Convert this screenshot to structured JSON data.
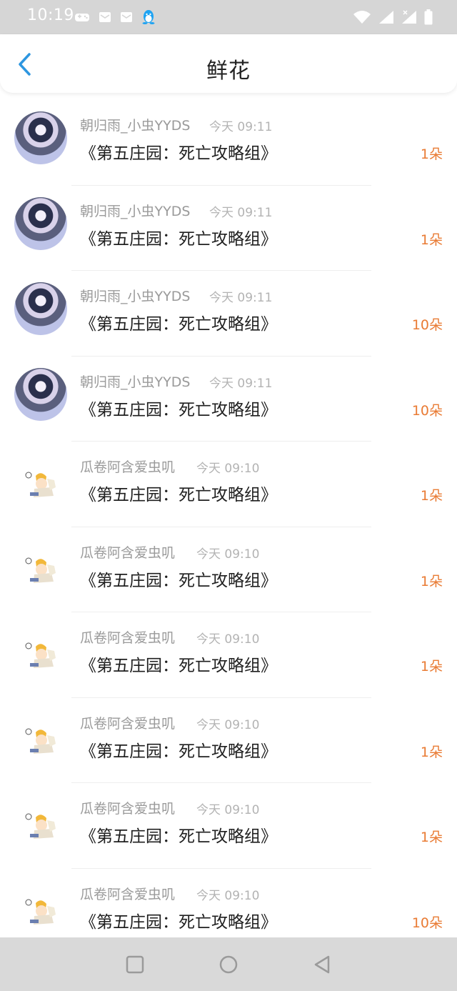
{
  "status_bar": {
    "time": "10:19",
    "left_icons": [
      "game-controller-icon",
      "mail-icon",
      "mail-icon",
      "qq-penguin-icon"
    ],
    "right_icons": [
      "wifi-icon",
      "signal-icon",
      "signal-icon",
      "battery-icon"
    ]
  },
  "header": {
    "title": "鲜花"
  },
  "colors": {
    "accent_blue": "#2d96e0",
    "count_orange": "#e97b34",
    "name_gray": "#9a9a9a",
    "time_gray": "#b3b3b3"
  },
  "items": [
    {
      "name": "朝归雨_小虫YYDS",
      "time": "今天 09:11",
      "title": "《第五庄园：死亡攻略组》",
      "count": "1朵"
    },
    {
      "name": "朝归雨_小虫YYDS",
      "time": "今天 09:11",
      "title": "《第五庄园：死亡攻略组》",
      "count": "1朵"
    },
    {
      "name": "朝归雨_小虫YYDS",
      "time": "今天 09:11",
      "title": "《第五庄园：死亡攻略组》",
      "count": "10朵"
    },
    {
      "name": "朝归雨_小虫YYDS",
      "time": "今天 09:11",
      "title": "《第五庄园：死亡攻略组》",
      "count": "10朵"
    },
    {
      "name": "瓜卷阿含爱虫叽",
      "time": "今天 09:10",
      "title": "《第五庄园：死亡攻略组》",
      "count": "1朵"
    },
    {
      "name": "瓜卷阿含爱虫叽",
      "time": "今天 09:10",
      "title": "《第五庄园：死亡攻略组》",
      "count": "1朵"
    },
    {
      "name": "瓜卷阿含爱虫叽",
      "time": "今天 09:10",
      "title": "《第五庄园：死亡攻略组》",
      "count": "1朵"
    },
    {
      "name": "瓜卷阿含爱虫叽",
      "time": "今天 09:10",
      "title": "《第五庄园：死亡攻略组》",
      "count": "1朵"
    },
    {
      "name": "瓜卷阿含爱虫叽",
      "time": "今天 09:10",
      "title": "《第五庄园：死亡攻略组》",
      "count": "1朵"
    },
    {
      "name": "瓜卷阿含爱虫叽",
      "time": "今天 09:10",
      "title": "《第五庄园：死亡攻略组》",
      "count": "10朵"
    }
  ],
  "nav_bar": {
    "buttons": [
      "recents-square-icon",
      "home-circle-icon",
      "back-triangle-icon"
    ]
  }
}
